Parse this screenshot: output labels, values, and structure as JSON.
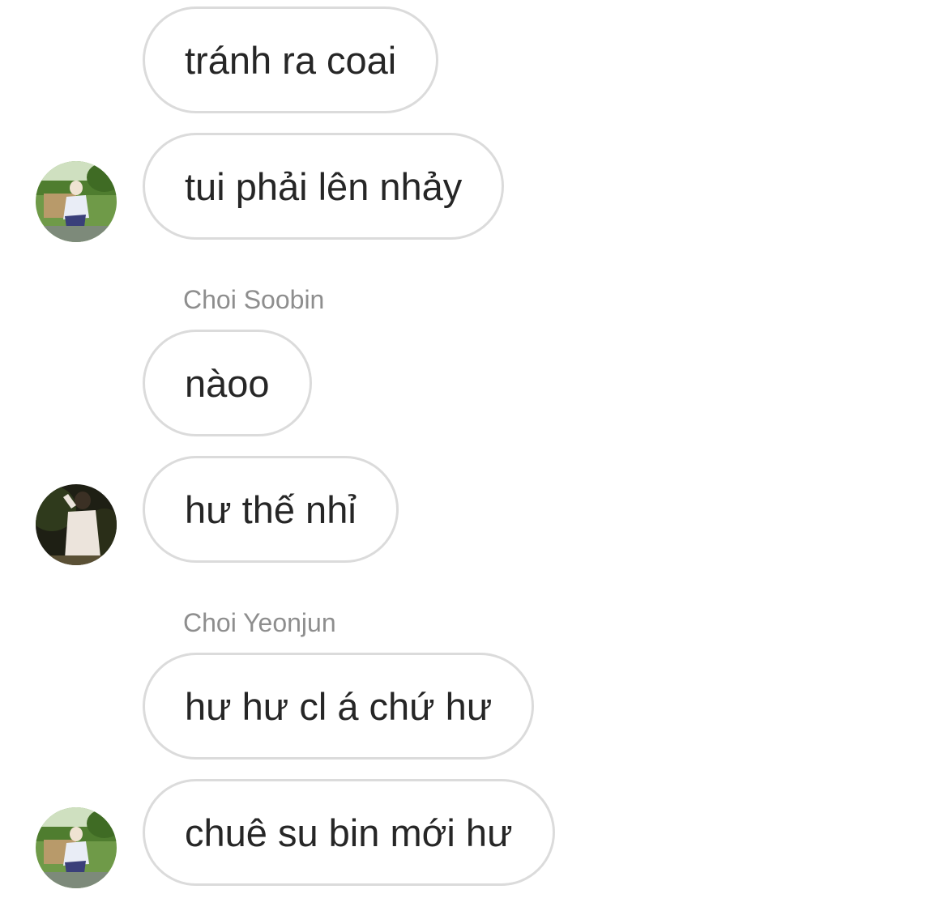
{
  "conversation": {
    "messages": [
      {
        "text": "tránh ra coai"
      },
      {
        "text": "tui phải lên nhảy"
      },
      {
        "text": "nàoo"
      },
      {
        "text": "hư thế nhỉ"
      },
      {
        "text": "hư hư cl á chứ hư"
      },
      {
        "text": "chuê su bin mới hư"
      }
    ],
    "senders": [
      {
        "name": "Choi Soobin"
      },
      {
        "name": "Choi Yeonjun"
      }
    ]
  },
  "colors": {
    "bubble_border": "#dbdbdb",
    "message_text": "#262626",
    "sender_name": "#8e8e8e",
    "background": "#ffffff"
  },
  "icons": {
    "avatar_a": "profile-photo-outdoor-green",
    "avatar_b": "profile-photo-dark-night"
  }
}
